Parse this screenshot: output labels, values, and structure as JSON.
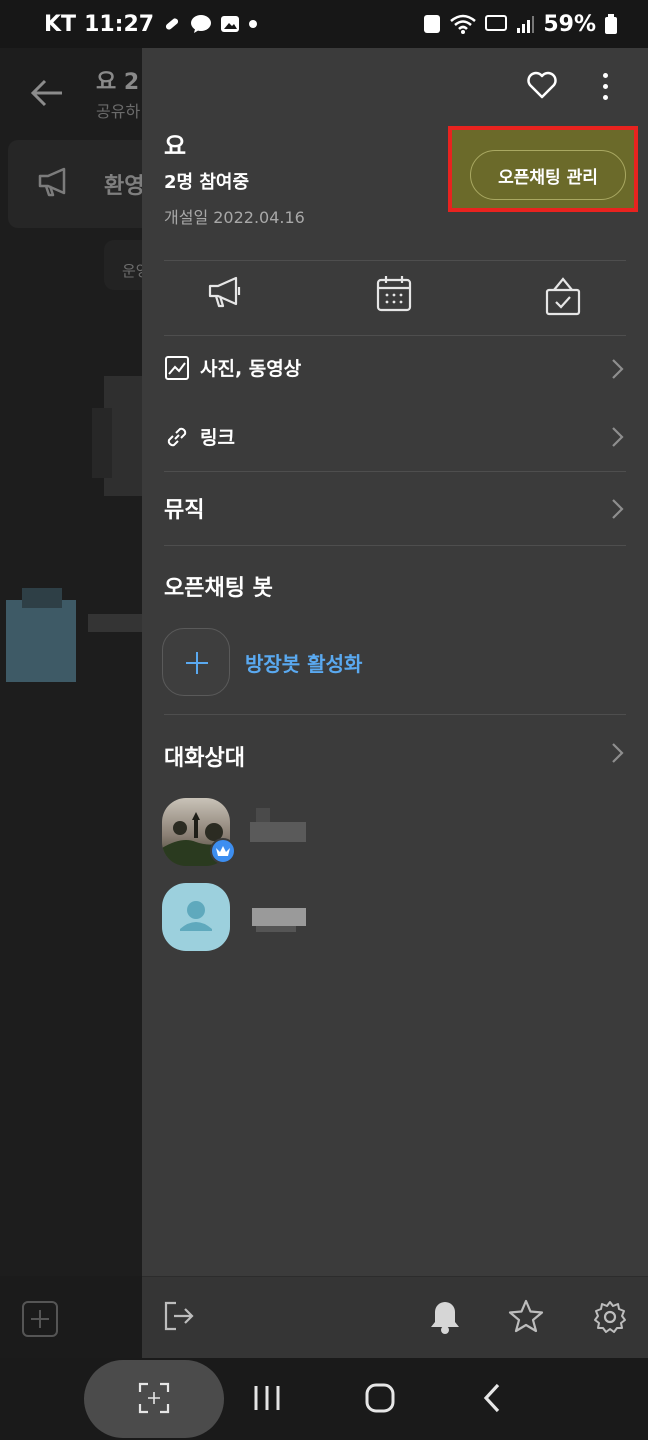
{
  "status_bar": {
    "carrier": "KT",
    "time": "11:27",
    "battery": "59%"
  },
  "background_chat": {
    "title": "요 2",
    "subtitle": "공유하",
    "notice": "환영합",
    "pill": "운영"
  },
  "drawer": {
    "room_name": "요",
    "participants": "2명 참여중",
    "opened_date": "개설일 2022.04.16",
    "manage_button": "오픈채팅 관리",
    "menu": {
      "photos": "사진, 동영상",
      "links": "링크",
      "music": "뮤직"
    },
    "bot_section": {
      "title": "오픈채팅 봇",
      "activate": "방장봇 활성화"
    },
    "members_section": {
      "title": "대화상대"
    }
  },
  "colors": {
    "accent": "#5aa9f0",
    "highlight_border": "#e8231f",
    "drawer_bg": "#3b3b3b"
  }
}
